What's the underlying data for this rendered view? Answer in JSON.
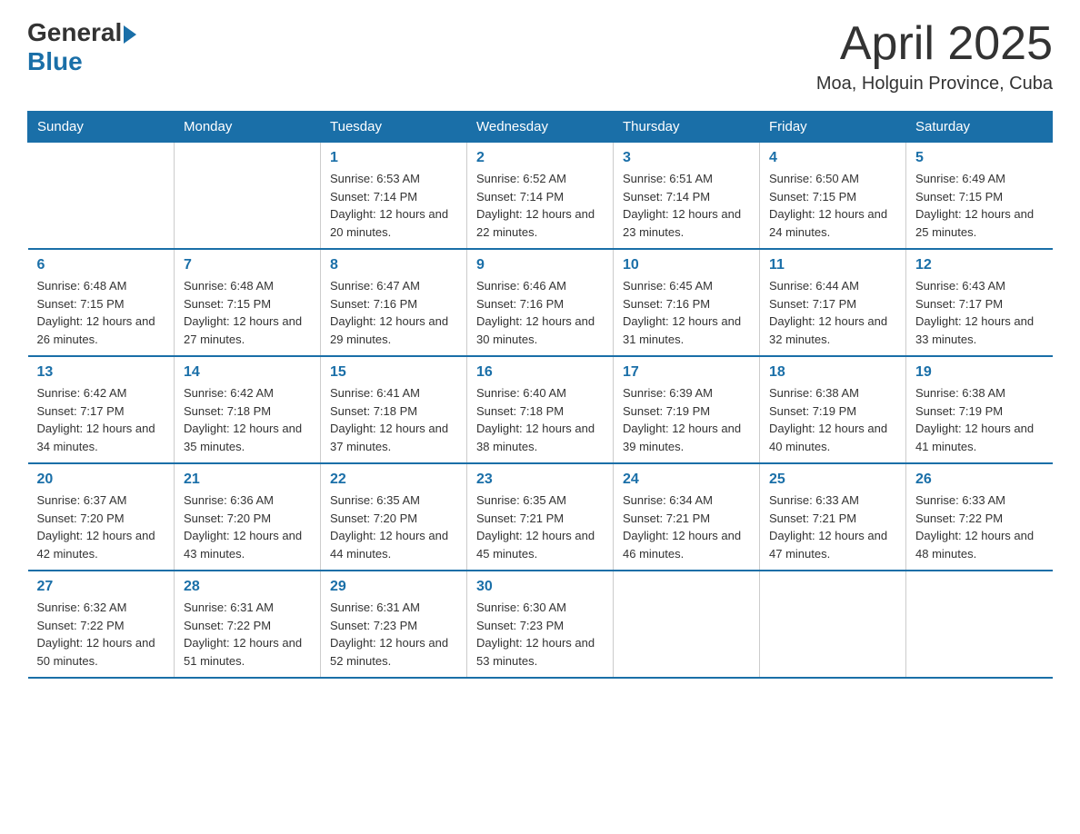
{
  "header": {
    "logo_general": "General",
    "logo_blue": "Blue",
    "title": "April 2025",
    "subtitle": "Moa, Holguin Province, Cuba"
  },
  "weekdays": [
    "Sunday",
    "Monday",
    "Tuesday",
    "Wednesday",
    "Thursday",
    "Friday",
    "Saturday"
  ],
  "weeks": [
    [
      {
        "day": "",
        "sunrise": "",
        "sunset": "",
        "daylight": ""
      },
      {
        "day": "",
        "sunrise": "",
        "sunset": "",
        "daylight": ""
      },
      {
        "day": "1",
        "sunrise": "Sunrise: 6:53 AM",
        "sunset": "Sunset: 7:14 PM",
        "daylight": "Daylight: 12 hours and 20 minutes."
      },
      {
        "day": "2",
        "sunrise": "Sunrise: 6:52 AM",
        "sunset": "Sunset: 7:14 PM",
        "daylight": "Daylight: 12 hours and 22 minutes."
      },
      {
        "day": "3",
        "sunrise": "Sunrise: 6:51 AM",
        "sunset": "Sunset: 7:14 PM",
        "daylight": "Daylight: 12 hours and 23 minutes."
      },
      {
        "day": "4",
        "sunrise": "Sunrise: 6:50 AM",
        "sunset": "Sunset: 7:15 PM",
        "daylight": "Daylight: 12 hours and 24 minutes."
      },
      {
        "day": "5",
        "sunrise": "Sunrise: 6:49 AM",
        "sunset": "Sunset: 7:15 PM",
        "daylight": "Daylight: 12 hours and 25 minutes."
      }
    ],
    [
      {
        "day": "6",
        "sunrise": "Sunrise: 6:48 AM",
        "sunset": "Sunset: 7:15 PM",
        "daylight": "Daylight: 12 hours and 26 minutes."
      },
      {
        "day": "7",
        "sunrise": "Sunrise: 6:48 AM",
        "sunset": "Sunset: 7:15 PM",
        "daylight": "Daylight: 12 hours and 27 minutes."
      },
      {
        "day": "8",
        "sunrise": "Sunrise: 6:47 AM",
        "sunset": "Sunset: 7:16 PM",
        "daylight": "Daylight: 12 hours and 29 minutes."
      },
      {
        "day": "9",
        "sunrise": "Sunrise: 6:46 AM",
        "sunset": "Sunset: 7:16 PM",
        "daylight": "Daylight: 12 hours and 30 minutes."
      },
      {
        "day": "10",
        "sunrise": "Sunrise: 6:45 AM",
        "sunset": "Sunset: 7:16 PM",
        "daylight": "Daylight: 12 hours and 31 minutes."
      },
      {
        "day": "11",
        "sunrise": "Sunrise: 6:44 AM",
        "sunset": "Sunset: 7:17 PM",
        "daylight": "Daylight: 12 hours and 32 minutes."
      },
      {
        "day": "12",
        "sunrise": "Sunrise: 6:43 AM",
        "sunset": "Sunset: 7:17 PM",
        "daylight": "Daylight: 12 hours and 33 minutes."
      }
    ],
    [
      {
        "day": "13",
        "sunrise": "Sunrise: 6:42 AM",
        "sunset": "Sunset: 7:17 PM",
        "daylight": "Daylight: 12 hours and 34 minutes."
      },
      {
        "day": "14",
        "sunrise": "Sunrise: 6:42 AM",
        "sunset": "Sunset: 7:18 PM",
        "daylight": "Daylight: 12 hours and 35 minutes."
      },
      {
        "day": "15",
        "sunrise": "Sunrise: 6:41 AM",
        "sunset": "Sunset: 7:18 PM",
        "daylight": "Daylight: 12 hours and 37 minutes."
      },
      {
        "day": "16",
        "sunrise": "Sunrise: 6:40 AM",
        "sunset": "Sunset: 7:18 PM",
        "daylight": "Daylight: 12 hours and 38 minutes."
      },
      {
        "day": "17",
        "sunrise": "Sunrise: 6:39 AM",
        "sunset": "Sunset: 7:19 PM",
        "daylight": "Daylight: 12 hours and 39 minutes."
      },
      {
        "day": "18",
        "sunrise": "Sunrise: 6:38 AM",
        "sunset": "Sunset: 7:19 PM",
        "daylight": "Daylight: 12 hours and 40 minutes."
      },
      {
        "day": "19",
        "sunrise": "Sunrise: 6:38 AM",
        "sunset": "Sunset: 7:19 PM",
        "daylight": "Daylight: 12 hours and 41 minutes."
      }
    ],
    [
      {
        "day": "20",
        "sunrise": "Sunrise: 6:37 AM",
        "sunset": "Sunset: 7:20 PM",
        "daylight": "Daylight: 12 hours and 42 minutes."
      },
      {
        "day": "21",
        "sunrise": "Sunrise: 6:36 AM",
        "sunset": "Sunset: 7:20 PM",
        "daylight": "Daylight: 12 hours and 43 minutes."
      },
      {
        "day": "22",
        "sunrise": "Sunrise: 6:35 AM",
        "sunset": "Sunset: 7:20 PM",
        "daylight": "Daylight: 12 hours and 44 minutes."
      },
      {
        "day": "23",
        "sunrise": "Sunrise: 6:35 AM",
        "sunset": "Sunset: 7:21 PM",
        "daylight": "Daylight: 12 hours and 45 minutes."
      },
      {
        "day": "24",
        "sunrise": "Sunrise: 6:34 AM",
        "sunset": "Sunset: 7:21 PM",
        "daylight": "Daylight: 12 hours and 46 minutes."
      },
      {
        "day": "25",
        "sunrise": "Sunrise: 6:33 AM",
        "sunset": "Sunset: 7:21 PM",
        "daylight": "Daylight: 12 hours and 47 minutes."
      },
      {
        "day": "26",
        "sunrise": "Sunrise: 6:33 AM",
        "sunset": "Sunset: 7:22 PM",
        "daylight": "Daylight: 12 hours and 48 minutes."
      }
    ],
    [
      {
        "day": "27",
        "sunrise": "Sunrise: 6:32 AM",
        "sunset": "Sunset: 7:22 PM",
        "daylight": "Daylight: 12 hours and 50 minutes."
      },
      {
        "day": "28",
        "sunrise": "Sunrise: 6:31 AM",
        "sunset": "Sunset: 7:22 PM",
        "daylight": "Daylight: 12 hours and 51 minutes."
      },
      {
        "day": "29",
        "sunrise": "Sunrise: 6:31 AM",
        "sunset": "Sunset: 7:23 PM",
        "daylight": "Daylight: 12 hours and 52 minutes."
      },
      {
        "day": "30",
        "sunrise": "Sunrise: 6:30 AM",
        "sunset": "Sunset: 7:23 PM",
        "daylight": "Daylight: 12 hours and 53 minutes."
      },
      {
        "day": "",
        "sunrise": "",
        "sunset": "",
        "daylight": ""
      },
      {
        "day": "",
        "sunrise": "",
        "sunset": "",
        "daylight": ""
      },
      {
        "day": "",
        "sunrise": "",
        "sunset": "",
        "daylight": ""
      }
    ]
  ]
}
